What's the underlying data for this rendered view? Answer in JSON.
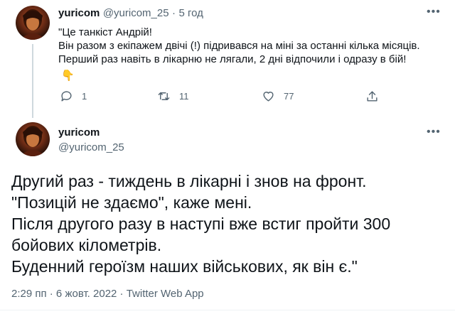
{
  "tweet1": {
    "display_name": "yuricom",
    "handle": "@yuricom_25",
    "separator": "·",
    "time": "5 год",
    "lines": [
      "\"Це танкіст Андрій!",
      "Він разом з екіпажем двічі (!) підривався на міні за останні кілька місяців.",
      "Перший раз навіть в лікарню не лягали, 2 дні відпочили і одразу в бій!"
    ],
    "emoji": "👇",
    "actions": {
      "replies": "1",
      "retweets": "11",
      "likes": "77"
    }
  },
  "tweet2": {
    "display_name": "yuricom",
    "handle": "@yuricom_25",
    "lines": [
      "Другий раз - тиждень в лікарні і знов на фронт.",
      "\"Позицій не здаємо\", каже мені.",
      "Після другого разу в наступі вже встиг пройти 300",
      "бойових кілометрів.",
      "Буденний героїзм наших військових, як він є.\""
    ],
    "meta": "2:29 пп · 6 жовт. 2022 · Twitter Web App"
  },
  "icons": {
    "more": "more-horizontal-icon",
    "reply": "reply-bubble-icon",
    "retweet": "retweet-icon",
    "like": "heart-icon",
    "share": "share-upload-icon"
  },
  "colors": {
    "text": "#0f1419",
    "muted": "#536471",
    "thread_line": "#cfd9de"
  }
}
